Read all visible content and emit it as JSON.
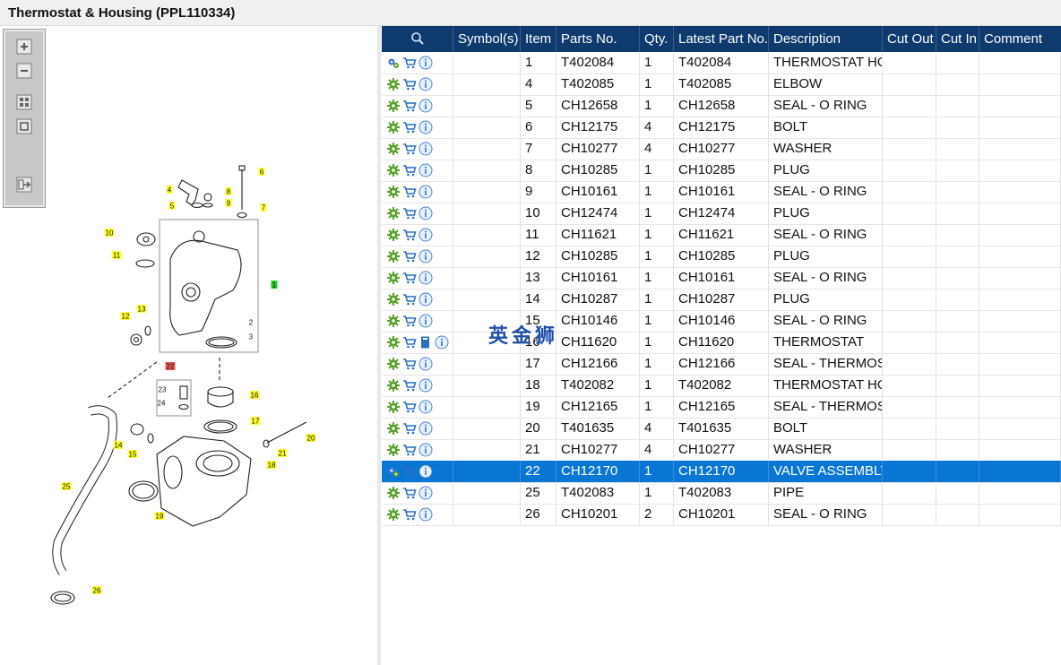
{
  "window": {
    "title": "Thermostat & Housing (PPL110334)"
  },
  "toolbox": {
    "buttons": [
      "zoom-in-icon",
      "zoom-out-icon",
      "fit-all-icon",
      "actual-size-icon",
      "export-icon"
    ]
  },
  "diagram": {
    "callouts": [
      {
        "label": "1",
        "color": "#22cc22"
      },
      {
        "label": "2",
        "color": "none"
      },
      {
        "label": "3",
        "color": "none"
      },
      {
        "label": "4",
        "color": "#ffff33"
      },
      {
        "label": "5",
        "color": "#ffff33"
      },
      {
        "label": "6",
        "color": "#ffff33"
      },
      {
        "label": "7",
        "color": "#ffff33"
      },
      {
        "label": "8",
        "color": "#ffff33"
      },
      {
        "label": "9",
        "color": "#ffff33"
      },
      {
        "label": "10",
        "color": "#ffff33"
      },
      {
        "label": "11",
        "color": "#ffff33"
      },
      {
        "label": "12",
        "color": "#ffff33"
      },
      {
        "label": "13",
        "color": "#ffff33"
      },
      {
        "label": "14",
        "color": "#ffff33"
      },
      {
        "label": "15",
        "color": "#ffff33"
      },
      {
        "label": "16",
        "color": "#ffff33"
      },
      {
        "label": "17",
        "color": "#ffff33"
      },
      {
        "label": "18",
        "color": "#ffff33"
      },
      {
        "label": "19",
        "color": "#ffff33"
      },
      {
        "label": "20",
        "color": "#ffff33"
      },
      {
        "label": "21",
        "color": "#ffff33"
      },
      {
        "label": "22",
        "color": "#ee5555"
      },
      {
        "label": "23",
        "color": "none"
      },
      {
        "label": "24",
        "color": "none"
      },
      {
        "label": "25",
        "color": "#ffff33"
      },
      {
        "label": "26",
        "color": "#ffff33"
      }
    ]
  },
  "table": {
    "header_icon": "search-icon",
    "columns": [
      "Symbol(s)",
      "Item",
      "Parts No.",
      "Qty.",
      "Latest Part No.",
      "Description",
      "Cut Out",
      "Cut In",
      "Comment"
    ],
    "rows": [
      {
        "item": "1",
        "part": "T402084",
        "qty": "1",
        "latest": "T402084",
        "desc": "THERMOSTAT HOUSING",
        "selected": false,
        "icons": [
          "gears-icon",
          "cart-icon",
          "info-icon"
        ]
      },
      {
        "item": "4",
        "part": "T402085",
        "qty": "1",
        "latest": "T402085",
        "desc": "ELBOW",
        "selected": false,
        "icons": [
          "gear-icon",
          "cart-icon",
          "info-icon"
        ]
      },
      {
        "item": "5",
        "part": "CH12658",
        "qty": "1",
        "latest": "CH12658",
        "desc": "SEAL - O RING",
        "selected": false,
        "icons": [
          "gear-icon",
          "cart-icon",
          "info-icon"
        ]
      },
      {
        "item": "6",
        "part": "CH12175",
        "qty": "4",
        "latest": "CH12175",
        "desc": "BOLT",
        "selected": false,
        "icons": [
          "gear-icon",
          "cart-icon",
          "info-icon"
        ]
      },
      {
        "item": "7",
        "part": "CH10277",
        "qty": "4",
        "latest": "CH10277",
        "desc": "WASHER",
        "selected": false,
        "icons": [
          "gear-icon",
          "cart-icon",
          "info-icon"
        ]
      },
      {
        "item": "8",
        "part": "CH10285",
        "qty": "1",
        "latest": "CH10285",
        "desc": "PLUG",
        "selected": false,
        "icons": [
          "gear-icon",
          "cart-icon",
          "info-icon"
        ]
      },
      {
        "item": "9",
        "part": "CH10161",
        "qty": "1",
        "latest": "CH10161",
        "desc": "SEAL - O RING",
        "selected": false,
        "icons": [
          "gear-icon",
          "cart-icon",
          "info-icon"
        ]
      },
      {
        "item": "10",
        "part": "CH12474",
        "qty": "1",
        "latest": "CH12474",
        "desc": "PLUG",
        "selected": false,
        "icons": [
          "gear-icon",
          "cart-icon",
          "info-icon"
        ]
      },
      {
        "item": "11",
        "part": "CH11621",
        "qty": "1",
        "latest": "CH11621",
        "desc": "SEAL - O RING",
        "selected": false,
        "icons": [
          "gear-icon",
          "cart-icon",
          "info-icon"
        ]
      },
      {
        "item": "12",
        "part": "CH10285",
        "qty": "1",
        "latest": "CH10285",
        "desc": "PLUG",
        "selected": false,
        "icons": [
          "gear-icon",
          "cart-icon",
          "info-icon"
        ]
      },
      {
        "item": "13",
        "part": "CH10161",
        "qty": "1",
        "latest": "CH10161",
        "desc": "SEAL - O RING",
        "selected": false,
        "icons": [
          "gear-icon",
          "cart-icon",
          "info-icon"
        ]
      },
      {
        "item": "14",
        "part": "CH10287",
        "qty": "1",
        "latest": "CH10287",
        "desc": "PLUG",
        "selected": false,
        "icons": [
          "gear-icon",
          "cart-icon",
          "info-icon"
        ]
      },
      {
        "item": "15",
        "part": "CH10146",
        "qty": "1",
        "latest": "CH10146",
        "desc": "SEAL - O RING",
        "selected": false,
        "icons": [
          "gear-icon",
          "cart-icon",
          "info-icon"
        ]
      },
      {
        "item": "16",
        "part": "CH11620",
        "qty": "1",
        "latest": "CH11620",
        "desc": "THERMOSTAT",
        "selected": false,
        "icons": [
          "gear-icon",
          "cart-icon",
          "book-icon",
          "info-icon"
        ]
      },
      {
        "item": "17",
        "part": "CH12166",
        "qty": "1",
        "latest": "CH12166",
        "desc": "SEAL - THERMOSTAT",
        "selected": false,
        "icons": [
          "gear-icon",
          "cart-icon",
          "info-icon"
        ]
      },
      {
        "item": "18",
        "part": "T402082",
        "qty": "1",
        "latest": "T402082",
        "desc": "THERMOSTAT HOUSING",
        "selected": false,
        "icons": [
          "gear-icon",
          "cart-icon",
          "info-icon"
        ]
      },
      {
        "item": "19",
        "part": "CH12165",
        "qty": "1",
        "latest": "CH12165",
        "desc": "SEAL - THERMOSTAT",
        "selected": false,
        "icons": [
          "gear-icon",
          "cart-icon",
          "info-icon"
        ]
      },
      {
        "item": "20",
        "part": "T401635",
        "qty": "4",
        "latest": "T401635",
        "desc": "BOLT",
        "selected": false,
        "icons": [
          "gear-icon",
          "cart-icon",
          "info-icon"
        ]
      },
      {
        "item": "21",
        "part": "CH10277",
        "qty": "4",
        "latest": "CH10277",
        "desc": "WASHER",
        "selected": false,
        "icons": [
          "gear-icon",
          "cart-icon",
          "info-icon"
        ]
      },
      {
        "item": "22",
        "part": "CH12170",
        "qty": "1",
        "latest": "CH12170",
        "desc": "VALVE ASSEMBLY",
        "selected": true,
        "icons": [
          "gears-icon",
          "cart-icon",
          "info-icon"
        ]
      },
      {
        "item": "25",
        "part": "T402083",
        "qty": "1",
        "latest": "T402083",
        "desc": "PIPE",
        "selected": false,
        "icons": [
          "gear-icon",
          "cart-icon",
          "info-icon"
        ]
      },
      {
        "item": "26",
        "part": "CH10201",
        "qty": "2",
        "latest": "CH10201",
        "desc": "SEAL - O RING",
        "selected": false,
        "icons": [
          "gear-icon",
          "cart-icon",
          "info-icon"
        ]
      }
    ]
  },
  "watermark": "英金狮",
  "colors": {
    "header_bg": "#0f3a6e",
    "selected_row": "#0a76d3",
    "callout_yellow": "#ffff33",
    "callout_green": "#22cc22",
    "callout_red": "#ee5555"
  }
}
